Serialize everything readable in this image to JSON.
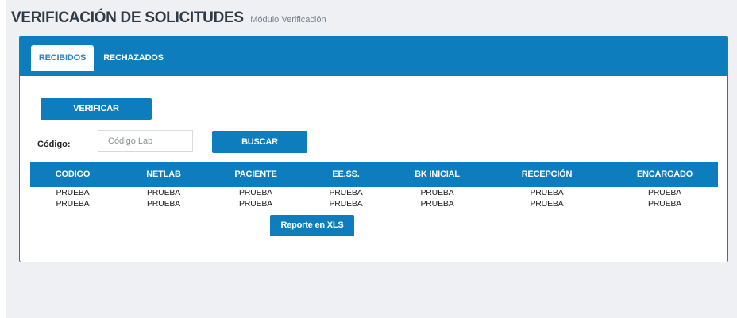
{
  "header": {
    "title": "VERIFICACIÓN DE SOLICITUDES",
    "subtitle": "Módulo Verificación"
  },
  "tabs": [
    {
      "label": "RECIBIDOS",
      "active": true
    },
    {
      "label": "RECHAZADOS",
      "active": false
    }
  ],
  "actions": {
    "verificar_label": "VERIFICAR",
    "buscar_label": "BUSCAR",
    "reporte_label": "Reporte en XLS"
  },
  "search": {
    "label": "Código:",
    "placeholder": "Código Lab",
    "value": ""
  },
  "table": {
    "headers": [
      "CODIGO",
      "NETLAB",
      "PACIENTE",
      "EE.SS.",
      "BK INICIAL",
      "RECEPCIÓN",
      "ENCARGADO"
    ],
    "rows": [
      [
        "PRUEBA",
        "PRUEBA",
        "PRUEBA",
        "PRUEBA",
        "PRUEBA",
        "PRUEBA",
        "PRUEBA"
      ],
      [
        "PRUEBA",
        "PRUEBA",
        "PRUEBA",
        "PRUEBA",
        "PRUEBA",
        "PRUEBA",
        "PRUEBA"
      ]
    ]
  },
  "colors": {
    "primary": "#0e7dbd",
    "background": "#eef0f4",
    "title": "#2f3a44"
  }
}
